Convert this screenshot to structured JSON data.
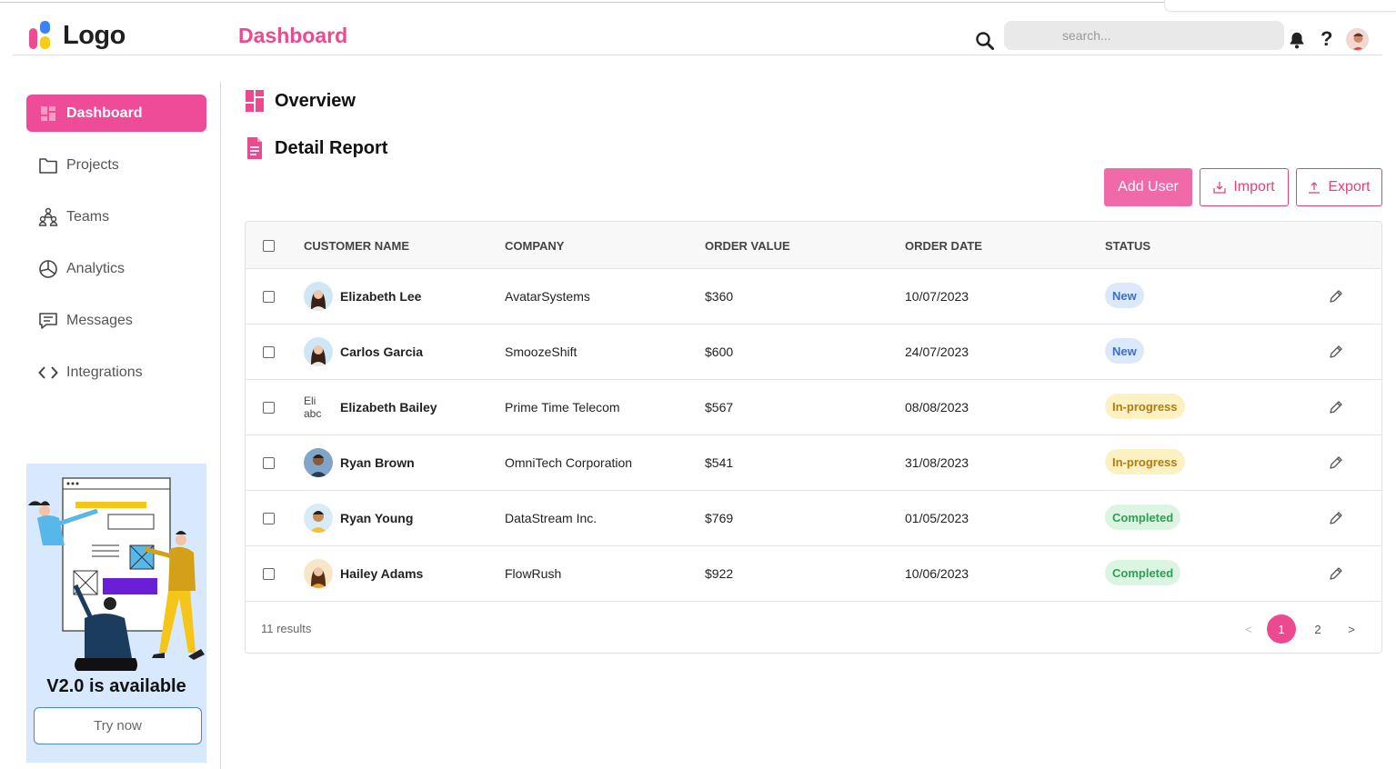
{
  "header": {
    "logo_text": "Logo",
    "page_title": "Dashboard",
    "search_placeholder": "search...",
    "help_label": "?"
  },
  "sidebar": {
    "items": [
      {
        "label": "Dashboard",
        "icon": "grid-icon",
        "active": true
      },
      {
        "label": "Projects",
        "icon": "folder-icon"
      },
      {
        "label": "Teams",
        "icon": "team-icon"
      },
      {
        "label": "Analytics",
        "icon": "pie-chart-icon"
      },
      {
        "label": "Messages",
        "icon": "message-icon"
      },
      {
        "label": "Integrations",
        "icon": "code-icon"
      }
    ],
    "promo": {
      "title": "V2.0 is available",
      "button": "Try now"
    }
  },
  "main": {
    "overview_title": "Overview",
    "report_title": "Detail Report",
    "actions": {
      "add_user": "Add User",
      "import": "Import",
      "export": "Export"
    }
  },
  "table": {
    "columns": [
      "CUSTOMER NAME",
      "COMPANY",
      "ORDER VALUE",
      "ORDER DATE",
      "STATUS"
    ],
    "rows": [
      {
        "name": "Elizabeth Lee",
        "company": "AvatarSystems",
        "value": "$360",
        "date": "10/07/2023",
        "status": "New"
      },
      {
        "name": "Carlos Garcia",
        "company": "SmoozeShift",
        "value": "$600",
        "date": "24/07/2023",
        "status": "New"
      },
      {
        "name": "Elizabeth Bailey",
        "company": "Prime Time Telecom",
        "value": "$567",
        "date": "08/08/2023",
        "status": "In-progress",
        "broken_alt": "Eli abc"
      },
      {
        "name": "Ryan Brown",
        "company": "OmniTech Corporation",
        "value": "$541",
        "date": "31/08/2023",
        "status": "In-progress"
      },
      {
        "name": "Ryan Young",
        "company": "DataStream Inc.",
        "value": "$769",
        "date": "01/05/2023",
        "status": "Completed"
      },
      {
        "name": "Hailey Adams",
        "company": "FlowRush",
        "value": "$922",
        "date": "10/06/2023",
        "status": "Completed"
      }
    ],
    "results_text": "11 results",
    "pagination": {
      "prev": "<",
      "pages": [
        "1",
        "2"
      ],
      "next": ">",
      "current": "1"
    }
  },
  "colors": {
    "brand_pink": "#ec4a8f",
    "new": "#3a6fc4",
    "in_progress": "#b07b10",
    "completed": "#2f9d55"
  }
}
